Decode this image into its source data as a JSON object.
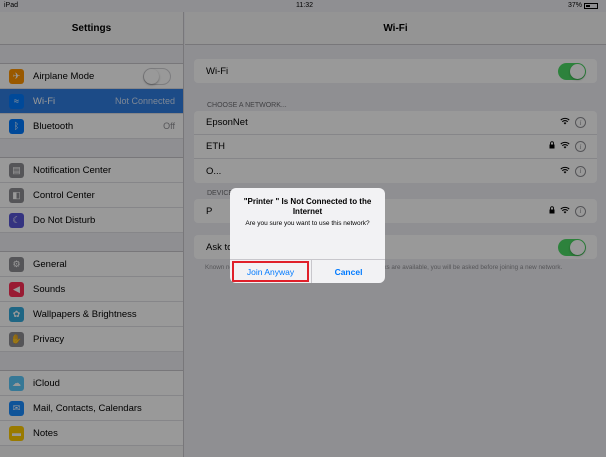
{
  "status_bar": {
    "carrier": "iPad",
    "time": "11:32",
    "battery": "37%"
  },
  "sidebar": {
    "title": "Settings",
    "groups": [
      [
        {
          "label": "Airplane Mode",
          "icon": "airplane-icon",
          "color": "#ff9500",
          "toggle": "off"
        },
        {
          "label": "Wi-Fi",
          "icon": "wifi-icon",
          "color": "#007aff",
          "value": "Not Connected",
          "selected": true
        },
        {
          "label": "Bluetooth",
          "icon": "bluetooth-icon",
          "color": "#007aff",
          "value": "Off"
        }
      ],
      [
        {
          "label": "Notification Center",
          "icon": "notification-icon",
          "color": "#8e8e93"
        },
        {
          "label": "Control Center",
          "icon": "control-center-icon",
          "color": "#8e8e93"
        },
        {
          "label": "Do Not Disturb",
          "icon": "moon-icon",
          "color": "#5856d6"
        }
      ],
      [
        {
          "label": "General",
          "icon": "gear-icon",
          "color": "#8e8e93"
        },
        {
          "label": "Sounds",
          "icon": "speaker-icon",
          "color": "#ff2d55"
        },
        {
          "label": "Wallpapers & Brightness",
          "icon": "flower-icon",
          "color": "#34aadc"
        },
        {
          "label": "Privacy",
          "icon": "hand-icon",
          "color": "#8e8e93"
        }
      ],
      [
        {
          "label": "iCloud",
          "icon": "cloud-icon",
          "color": "#5ac8fa"
        },
        {
          "label": "Mail, Contacts, Calendars",
          "icon": "mail-icon",
          "color": "#1a8cff"
        },
        {
          "label": "Notes",
          "icon": "notes-icon",
          "color": "#ffcc00"
        }
      ]
    ]
  },
  "main": {
    "title": "Wi-Fi",
    "wifi_row": {
      "label": "Wi-Fi",
      "toggle": "on"
    },
    "choose_network_header": "CHOOSE A NETWORK...",
    "networks": [
      {
        "name": "EpsonNet",
        "locked": false
      },
      {
        "name": "ETH",
        "locked": true
      },
      {
        "name": "O...",
        "locked": false
      }
    ],
    "devices_header": "DEVICE",
    "devices": [
      {
        "name": "P",
        "locked": true
      }
    ],
    "ask_to_join": {
      "label": "Ask to Join Networks",
      "toggle": "on"
    },
    "footnote": "Known networks will be joined automatically. If no known networks are available, you will be asked before joining a new network."
  },
  "alert": {
    "title": "\"Printer \" Is Not Connected to the Internet",
    "message": "Are you sure you want to use this network?",
    "join_label": "Join Anyway",
    "cancel_label": "Cancel",
    "highlight_color": "#e0202a"
  },
  "colors": {
    "accent": "#007aff",
    "toggle_on": "#4cd964",
    "selection": "#2f7de1"
  }
}
